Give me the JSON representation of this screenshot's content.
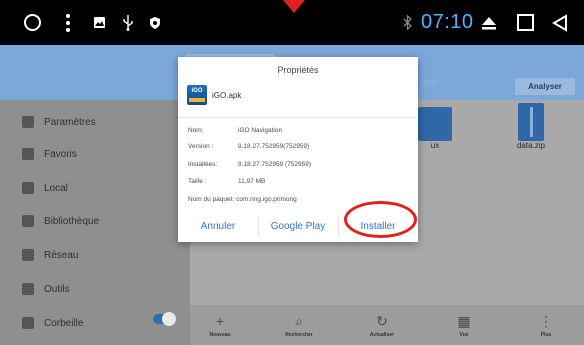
{
  "statusbar": {
    "time": "07:10",
    "time_color": "#4fb3ff",
    "icons": [
      "home-circle-icon",
      "more-vert-icon",
      "image-icon",
      "usb-icon",
      "shield-icon",
      "bluetooth-icon",
      "eject-icon",
      "recents-square-icon",
      "back-triangle-icon"
    ]
  },
  "app": {
    "header_color": "#7ba7d9",
    "analyse_label": "Analyser",
    "crumb": "IGO",
    "sidebar": [
      {
        "label": "Paramètres",
        "icon": "gear-icon"
      },
      {
        "label": "Favoris",
        "icon": "star-icon"
      },
      {
        "label": "Local",
        "icon": "phone-icon"
      },
      {
        "label": "Bibliothèque",
        "icon": "library-icon"
      },
      {
        "label": "Réseau",
        "icon": "network-icon"
      },
      {
        "label": "Outils",
        "icon": "wrench-icon"
      },
      {
        "label": "Corbeille",
        "icon": "trash-icon"
      }
    ],
    "files": [
      {
        "label": "ux",
        "icon": "folder-icon"
      },
      {
        "label": "data.zip",
        "icon": "zip-icon"
      }
    ],
    "bottom_actions": [
      {
        "label": "Nouveau",
        "icon": "plus-icon",
        "glyph": "+"
      },
      {
        "label": "Rechercher",
        "icon": "search-icon",
        "glyph": "⌕"
      },
      {
        "label": "Actualiser",
        "icon": "refresh-icon",
        "glyph": "↻"
      },
      {
        "label": "Vue",
        "icon": "grid-icon",
        "glyph": "▦"
      },
      {
        "label": "Plus",
        "icon": "more-vert-icon",
        "glyph": "⋮"
      }
    ]
  },
  "dialog": {
    "title": "Propriétés",
    "app_icon_text": "iGO",
    "file_name": "iGO.apk",
    "properties": [
      {
        "key": "Nom:",
        "value": "iGO Navigation"
      },
      {
        "key": "Version :",
        "value": "9.18.27.752959(752959)"
      },
      {
        "key": "Installées:",
        "value": "9.18.27.752959 (752959)"
      },
      {
        "key": "Taille :",
        "value": "11,97 MB"
      }
    ],
    "package_key": "Nom du paquet:",
    "package_value": "com.nng.igo.primong",
    "buttons": {
      "cancel": "Annuler",
      "google_play": "Google Play",
      "install": "Installer"
    },
    "button_color": "#2a76d2"
  },
  "annotation_color": "#e2201c"
}
